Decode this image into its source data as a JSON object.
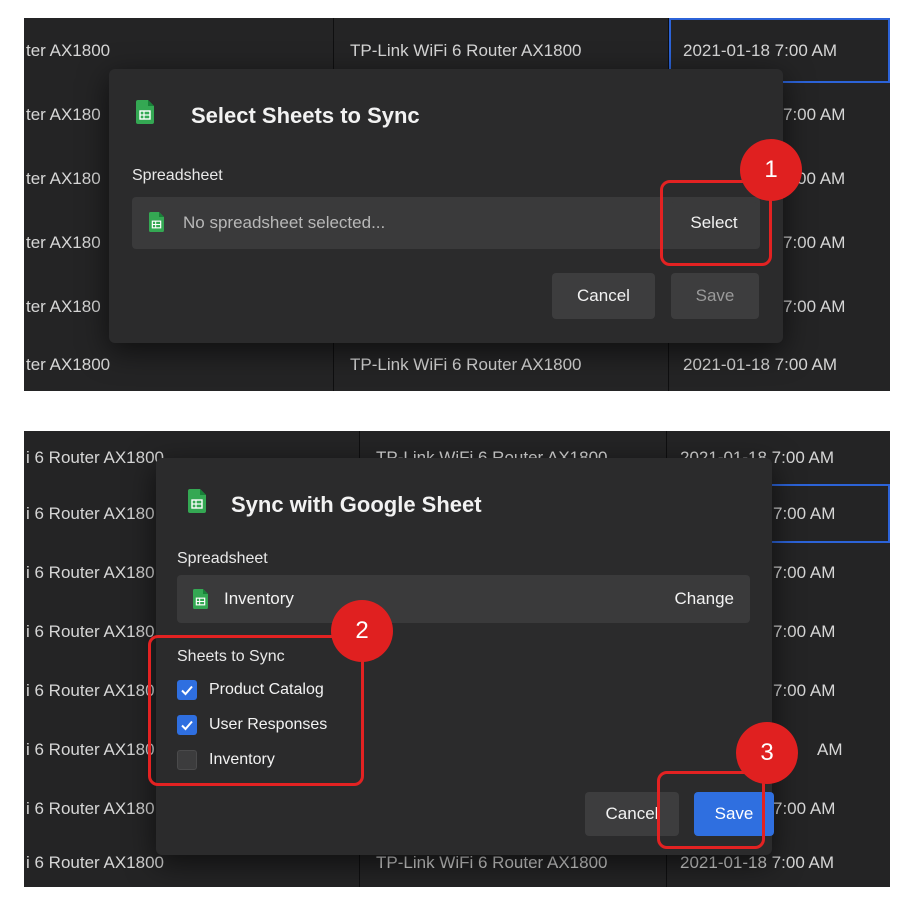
{
  "colors": {
    "accent": "#2f6fe0",
    "highlight": "#e32222",
    "sheets_green": "#34a853"
  },
  "panel1": {
    "rows": [
      {
        "col1": "ter AX1800",
        "col2": "TP-Link WiFi 6 Router AX1800",
        "col3": "2021-01-18 7:00 AM"
      },
      {
        "col1": "ter AX180",
        "col2": "",
        "col3": "7:00 AM"
      },
      {
        "col1": "ter AX180",
        "col2": "",
        "col3": "00 AM"
      },
      {
        "col1": "ter AX180",
        "col2": "",
        "col3": "7:00 AM"
      },
      {
        "col1": "ter AX180",
        "col2": "",
        "col3": "7:00 AM"
      },
      {
        "col1": "ter AX1800",
        "col2": "TP-Link WiFi 6 Router AX1800",
        "col3": "2021-01-18 7:00 AM"
      }
    ],
    "dialog": {
      "icon": "google-sheets-icon",
      "title": "Select Sheets to Sync",
      "spreadsheet_label": "Spreadsheet",
      "field_placeholder": "No spreadsheet selected...",
      "select_button": "Select",
      "cancel_button": "Cancel",
      "save_button": "Save"
    },
    "step_badge": "1"
  },
  "panel2": {
    "rows": [
      {
        "col1": "i 6 Router AX1800",
        "col2": "TP-Link WiFi 6 Router AX1800",
        "col3": "2021-01-18 7:00 AM"
      },
      {
        "col1": "i 6 Router AX180",
        "col2": "",
        "col3": "7:00 AM"
      },
      {
        "col1": "i 6 Router AX180",
        "col2": "",
        "col3": "7:00 AM"
      },
      {
        "col1": "i 6 Router AX180",
        "col2": "",
        "col3": "7:00 AM"
      },
      {
        "col1": "i 6 Router AX180",
        "col2": "",
        "col3": "7:00 AM"
      },
      {
        "col1": "i 6 Router AX180",
        "col2": "",
        "col3": "AM"
      },
      {
        "col1": "i 6 Router AX180",
        "col2": "",
        "col3": "7:00 AM"
      },
      {
        "col1": "i 6 Router AX1800",
        "col2": "TP-Link WiFi 6 Router AX1800",
        "col3": "2021-01-18 7:00 AM"
      }
    ],
    "dialog": {
      "icon": "google-sheets-icon",
      "title": "Sync with Google Sheet",
      "spreadsheet_label": "Spreadsheet",
      "spreadsheet_name": "Inventory",
      "change_button": "Change",
      "sheets_label": "Sheets to Sync",
      "sheets": [
        {
          "name": "Product Catalog",
          "checked": true
        },
        {
          "name": "User Responses",
          "checked": true
        },
        {
          "name": "Inventory",
          "checked": false
        }
      ],
      "cancel_button": "Cancel",
      "save_button": "Save"
    },
    "step_badges": [
      "2",
      "3"
    ]
  }
}
